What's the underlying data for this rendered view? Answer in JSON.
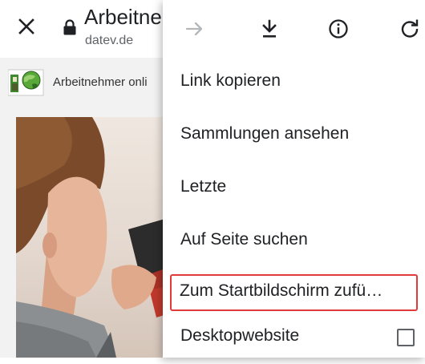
{
  "browser": {
    "title": "Arbeitneh",
    "domain": "datev.de",
    "icons": {
      "close": "close-icon",
      "lock": "lock-icon"
    }
  },
  "page": {
    "site_name": "Arbeitnehmer onli",
    "logo": "datev-logo-icon"
  },
  "menu": {
    "toolbar": {
      "forward": "arrow-forward-icon",
      "download": "download-icon",
      "info": "info-icon",
      "reload": "reload-icon"
    },
    "items": [
      {
        "label": "Link kopieren"
      },
      {
        "label": "Sammlungen ansehen"
      },
      {
        "label": "Letzte"
      },
      {
        "label": "Auf Seite suchen"
      },
      {
        "label": "Zum Startbildschirm zufü…",
        "highlighted": true,
        "highlight_color": "#e03a3a"
      },
      {
        "label": "Desktopwebsite",
        "checkbox": true,
        "checked": false
      }
    ]
  }
}
